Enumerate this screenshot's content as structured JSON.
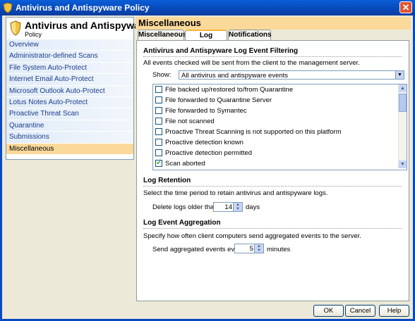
{
  "window": {
    "title": "Antivirus and Antispyware Policy",
    "close_label": "✕"
  },
  "nav": {
    "heading": "Antivirus and Antispyware",
    "subheading": "Policy",
    "items": [
      {
        "label": "Overview"
      },
      {
        "label": "Administrator-defined Scans"
      },
      {
        "label": "File System Auto-Protect"
      },
      {
        "label": "Internet Email Auto-Protect"
      },
      {
        "label": "Microsoft Outlook Auto-Protect"
      },
      {
        "label": "Lotus Notes Auto-Protect"
      },
      {
        "label": "Proactive Threat Scan"
      },
      {
        "label": "Quarantine"
      },
      {
        "label": "Submissions"
      },
      {
        "label": "Miscellaneous"
      }
    ],
    "active_index": 9
  },
  "panel": {
    "title": "Miscellaneous",
    "tabs": [
      {
        "label": "Miscellaneous"
      },
      {
        "label": "Log Handling"
      },
      {
        "label": "Notifications"
      }
    ],
    "active_tab": 1
  },
  "filtering": {
    "heading": "Antivirus and Antispyware Log Event Filtering",
    "description": "All events checked will be sent from the client to the management server.",
    "show_label": "Show:",
    "show_value": "All antivirus and antispyware events",
    "events": [
      {
        "label": "File backed up/restored to/from Quarantine",
        "checked": false
      },
      {
        "label": "File forwarded to Quarantine Server",
        "checked": false
      },
      {
        "label": "File forwarded to Symantec",
        "checked": false
      },
      {
        "label": "File not scanned",
        "checked": false
      },
      {
        "label": "Proactive Threat Scanning is not supported on this platform",
        "checked": false
      },
      {
        "label": "Proactive detection known",
        "checked": false
      },
      {
        "label": "Proactive detection permitted",
        "checked": false
      },
      {
        "label": "Scan aborted",
        "checked": true
      }
    ]
  },
  "retention": {
    "heading": "Log Retention",
    "description": "Select the time period to retain antivirus and antispyware logs.",
    "delete_label": "Delete logs older than:",
    "delete_value": "14",
    "unit": "days"
  },
  "aggregation": {
    "heading": "Log Event Aggregation",
    "description": "Specify how often client computers send aggregated events to the server.",
    "send_label": "Send aggregated events every:",
    "send_value": "5",
    "unit": "minutes"
  },
  "buttons": {
    "ok": "OK",
    "cancel": "Cancel",
    "help": "Help"
  },
  "colors": {
    "titlebar": "#0a5fd8",
    "active_nav": "#fbd99a",
    "nav_link": "#1b3c8c",
    "panel_header": "#fbd99a"
  }
}
